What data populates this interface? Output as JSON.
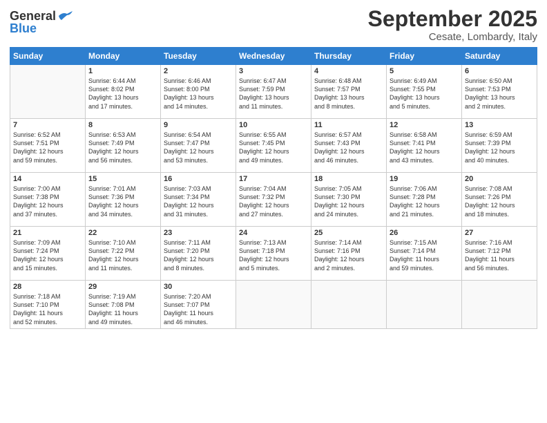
{
  "header": {
    "logo_general": "General",
    "logo_blue": "Blue",
    "month_title": "September 2025",
    "location": "Cesate, Lombardy, Italy"
  },
  "days_of_week": [
    "Sunday",
    "Monday",
    "Tuesday",
    "Wednesday",
    "Thursday",
    "Friday",
    "Saturday"
  ],
  "weeks": [
    [
      {
        "day": "",
        "data": ""
      },
      {
        "day": "1",
        "data": "Sunrise: 6:44 AM\nSunset: 8:02 PM\nDaylight: 13 hours\nand 17 minutes."
      },
      {
        "day": "2",
        "data": "Sunrise: 6:46 AM\nSunset: 8:00 PM\nDaylight: 13 hours\nand 14 minutes."
      },
      {
        "day": "3",
        "data": "Sunrise: 6:47 AM\nSunset: 7:59 PM\nDaylight: 13 hours\nand 11 minutes."
      },
      {
        "day": "4",
        "data": "Sunrise: 6:48 AM\nSunset: 7:57 PM\nDaylight: 13 hours\nand 8 minutes."
      },
      {
        "day": "5",
        "data": "Sunrise: 6:49 AM\nSunset: 7:55 PM\nDaylight: 13 hours\nand 5 minutes."
      },
      {
        "day": "6",
        "data": "Sunrise: 6:50 AM\nSunset: 7:53 PM\nDaylight: 13 hours\nand 2 minutes."
      }
    ],
    [
      {
        "day": "7",
        "data": "Sunrise: 6:52 AM\nSunset: 7:51 PM\nDaylight: 12 hours\nand 59 minutes."
      },
      {
        "day": "8",
        "data": "Sunrise: 6:53 AM\nSunset: 7:49 PM\nDaylight: 12 hours\nand 56 minutes."
      },
      {
        "day": "9",
        "data": "Sunrise: 6:54 AM\nSunset: 7:47 PM\nDaylight: 12 hours\nand 53 minutes."
      },
      {
        "day": "10",
        "data": "Sunrise: 6:55 AM\nSunset: 7:45 PM\nDaylight: 12 hours\nand 49 minutes."
      },
      {
        "day": "11",
        "data": "Sunrise: 6:57 AM\nSunset: 7:43 PM\nDaylight: 12 hours\nand 46 minutes."
      },
      {
        "day": "12",
        "data": "Sunrise: 6:58 AM\nSunset: 7:41 PM\nDaylight: 12 hours\nand 43 minutes."
      },
      {
        "day": "13",
        "data": "Sunrise: 6:59 AM\nSunset: 7:39 PM\nDaylight: 12 hours\nand 40 minutes."
      }
    ],
    [
      {
        "day": "14",
        "data": "Sunrise: 7:00 AM\nSunset: 7:38 PM\nDaylight: 12 hours\nand 37 minutes."
      },
      {
        "day": "15",
        "data": "Sunrise: 7:01 AM\nSunset: 7:36 PM\nDaylight: 12 hours\nand 34 minutes."
      },
      {
        "day": "16",
        "data": "Sunrise: 7:03 AM\nSunset: 7:34 PM\nDaylight: 12 hours\nand 31 minutes."
      },
      {
        "day": "17",
        "data": "Sunrise: 7:04 AM\nSunset: 7:32 PM\nDaylight: 12 hours\nand 27 minutes."
      },
      {
        "day": "18",
        "data": "Sunrise: 7:05 AM\nSunset: 7:30 PM\nDaylight: 12 hours\nand 24 minutes."
      },
      {
        "day": "19",
        "data": "Sunrise: 7:06 AM\nSunset: 7:28 PM\nDaylight: 12 hours\nand 21 minutes."
      },
      {
        "day": "20",
        "data": "Sunrise: 7:08 AM\nSunset: 7:26 PM\nDaylight: 12 hours\nand 18 minutes."
      }
    ],
    [
      {
        "day": "21",
        "data": "Sunrise: 7:09 AM\nSunset: 7:24 PM\nDaylight: 12 hours\nand 15 minutes."
      },
      {
        "day": "22",
        "data": "Sunrise: 7:10 AM\nSunset: 7:22 PM\nDaylight: 12 hours\nand 11 minutes."
      },
      {
        "day": "23",
        "data": "Sunrise: 7:11 AM\nSunset: 7:20 PM\nDaylight: 12 hours\nand 8 minutes."
      },
      {
        "day": "24",
        "data": "Sunrise: 7:13 AM\nSunset: 7:18 PM\nDaylight: 12 hours\nand 5 minutes."
      },
      {
        "day": "25",
        "data": "Sunrise: 7:14 AM\nSunset: 7:16 PM\nDaylight: 12 hours\nand 2 minutes."
      },
      {
        "day": "26",
        "data": "Sunrise: 7:15 AM\nSunset: 7:14 PM\nDaylight: 11 hours\nand 59 minutes."
      },
      {
        "day": "27",
        "data": "Sunrise: 7:16 AM\nSunset: 7:12 PM\nDaylight: 11 hours\nand 56 minutes."
      }
    ],
    [
      {
        "day": "28",
        "data": "Sunrise: 7:18 AM\nSunset: 7:10 PM\nDaylight: 11 hours\nand 52 minutes."
      },
      {
        "day": "29",
        "data": "Sunrise: 7:19 AM\nSunset: 7:08 PM\nDaylight: 11 hours\nand 49 minutes."
      },
      {
        "day": "30",
        "data": "Sunrise: 7:20 AM\nSunset: 7:07 PM\nDaylight: 11 hours\nand 46 minutes."
      },
      {
        "day": "",
        "data": ""
      },
      {
        "day": "",
        "data": ""
      },
      {
        "day": "",
        "data": ""
      },
      {
        "day": "",
        "data": ""
      }
    ]
  ]
}
